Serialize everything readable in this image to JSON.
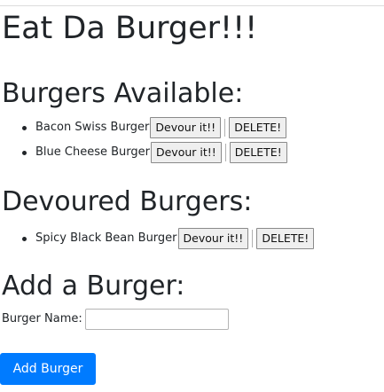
{
  "page": {
    "title": "Eat Da Burger!!!"
  },
  "available": {
    "heading": "Burgers Available:",
    "burgers": [
      {
        "name": "Bacon Swiss Burger",
        "devour_label": "Devour it!!",
        "delete_label": "DELETE!"
      },
      {
        "name": "Blue Cheese Burger",
        "devour_label": "Devour it!!",
        "delete_label": "DELETE!"
      }
    ]
  },
  "devoured": {
    "heading": "Devoured Burgers:",
    "burgers": [
      {
        "name": "Spicy Black Bean Burger",
        "devour_label": "Devour it!!",
        "delete_label": "DELETE!"
      }
    ]
  },
  "add_form": {
    "heading": "Add a Burger:",
    "label": "Burger Name:",
    "input_value": "",
    "input_placeholder": "",
    "submit_label": "Add Burger"
  },
  "colors": {
    "primary_button": "#007bff",
    "text": "#212529"
  }
}
